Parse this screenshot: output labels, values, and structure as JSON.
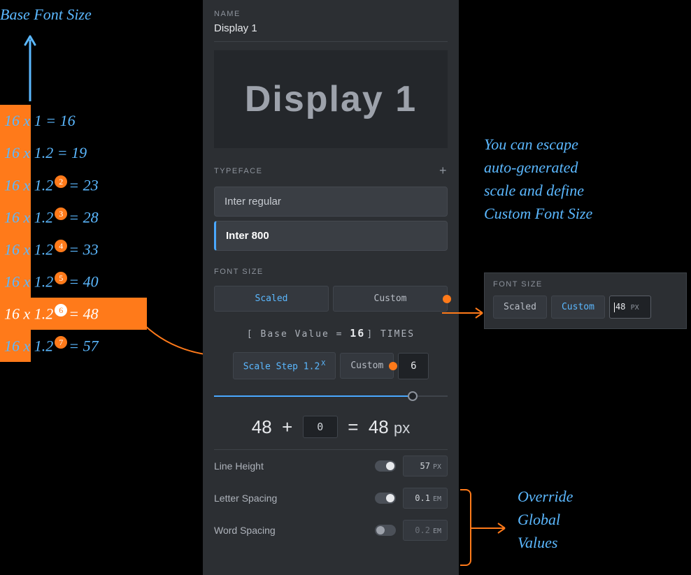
{
  "annotations": {
    "base_font_size": "Base Font Size",
    "escape_note_l1": "You can escape",
    "escape_note_l2": "auto-generated",
    "escape_note_l3": "scale and define",
    "escape_note_l4": "Custom Font Size",
    "override_l1": "Override",
    "override_l2": "Global",
    "override_l3": "Values"
  },
  "scale": {
    "base": "16",
    "ratio": "1.2",
    "rows": [
      {
        "exp": "",
        "result": "16",
        "formula": "16 x 1 = 16"
      },
      {
        "exp": "",
        "result": "19",
        "formula": "16 x 1.2 = 19"
      },
      {
        "exp": "2",
        "result": "23"
      },
      {
        "exp": "3",
        "result": "28"
      },
      {
        "exp": "4",
        "result": "33"
      },
      {
        "exp": "5",
        "result": "40"
      },
      {
        "exp": "6",
        "result": "48"
      },
      {
        "exp": "7",
        "result": "57"
      }
    ]
  },
  "panel": {
    "name_label": "NAME",
    "name_value": "Display 1",
    "preview_text": "Display 1",
    "typeface_label": "TYPEFACE",
    "fonts": [
      "Inter regular",
      "Inter 800"
    ],
    "fontsize_label": "FONT SIZE",
    "tabs": {
      "scaled": "Scaled",
      "custom": "Custom"
    },
    "formula_prefix": "[ Base Value =",
    "formula_base": "16",
    "formula_suffix": "] TIMES",
    "step_scaled_label": "Scale Step 1.2",
    "step_exp": "X",
    "step_custom_label": "Custom",
    "step_value": "6",
    "result_a": "48",
    "result_adj": "0",
    "result_b": "48",
    "result_unit": "px",
    "props": {
      "line_height": {
        "label": "Line Height",
        "value": "57",
        "unit": "PX",
        "on": true
      },
      "letter_spacing": {
        "label": "Letter Spacing",
        "value": "0.1",
        "unit": "EM",
        "on": true
      },
      "word_spacing": {
        "label": "Word Spacing",
        "value": "0.2",
        "unit": "EM",
        "on": false
      }
    }
  },
  "mini": {
    "label": "FONT SIZE",
    "scaled": "Scaled",
    "custom": "Custom",
    "value": "48",
    "unit": "PX"
  }
}
